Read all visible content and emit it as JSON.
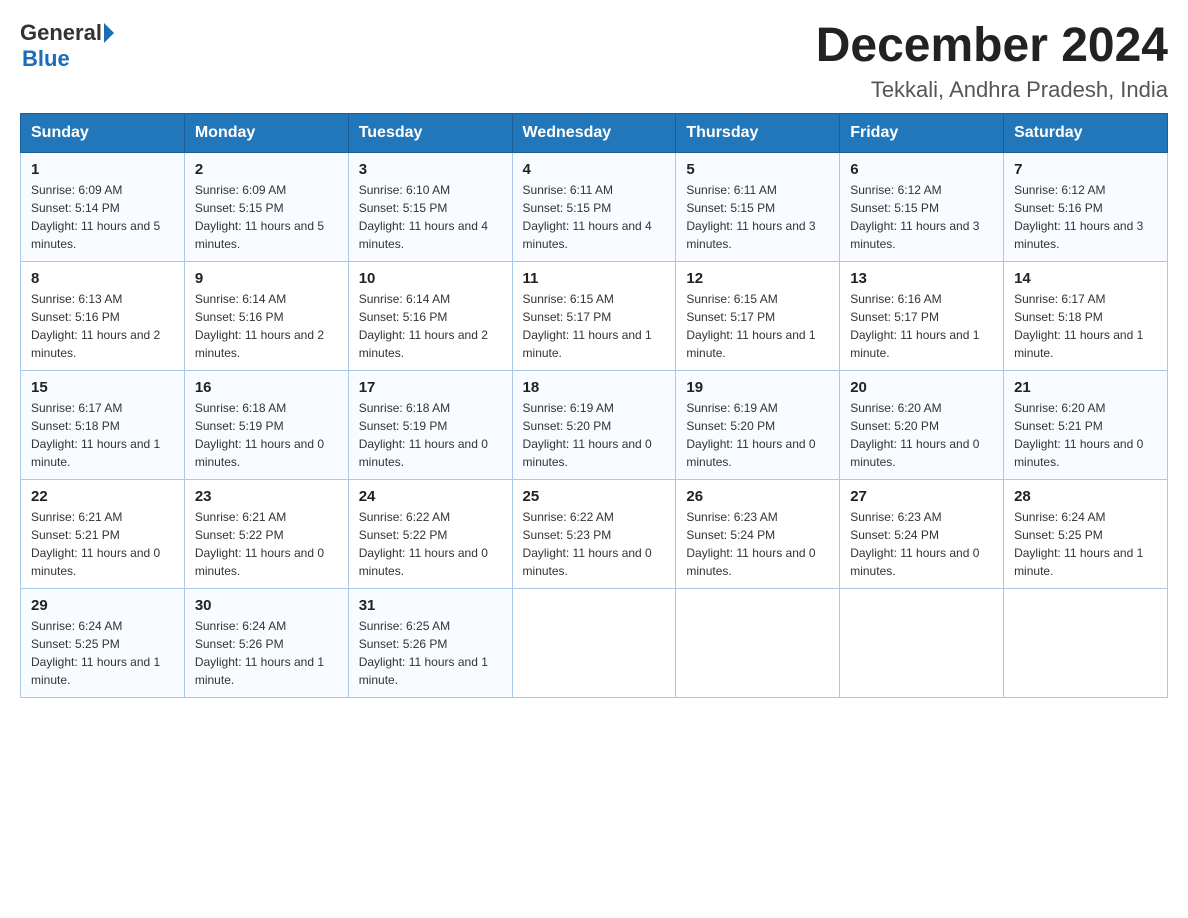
{
  "header": {
    "logo": {
      "general": "General",
      "blue": "Blue"
    },
    "month_title": "December 2024",
    "location": "Tekkali, Andhra Pradesh, India"
  },
  "calendar": {
    "days_of_week": [
      "Sunday",
      "Monday",
      "Tuesday",
      "Wednesday",
      "Thursday",
      "Friday",
      "Saturday"
    ],
    "weeks": [
      [
        {
          "day": "1",
          "sunrise": "Sunrise: 6:09 AM",
          "sunset": "Sunset: 5:14 PM",
          "daylight": "Daylight: 11 hours and 5 minutes."
        },
        {
          "day": "2",
          "sunrise": "Sunrise: 6:09 AM",
          "sunset": "Sunset: 5:15 PM",
          "daylight": "Daylight: 11 hours and 5 minutes."
        },
        {
          "day": "3",
          "sunrise": "Sunrise: 6:10 AM",
          "sunset": "Sunset: 5:15 PM",
          "daylight": "Daylight: 11 hours and 4 minutes."
        },
        {
          "day": "4",
          "sunrise": "Sunrise: 6:11 AM",
          "sunset": "Sunset: 5:15 PM",
          "daylight": "Daylight: 11 hours and 4 minutes."
        },
        {
          "day": "5",
          "sunrise": "Sunrise: 6:11 AM",
          "sunset": "Sunset: 5:15 PM",
          "daylight": "Daylight: 11 hours and 3 minutes."
        },
        {
          "day": "6",
          "sunrise": "Sunrise: 6:12 AM",
          "sunset": "Sunset: 5:15 PM",
          "daylight": "Daylight: 11 hours and 3 minutes."
        },
        {
          "day": "7",
          "sunrise": "Sunrise: 6:12 AM",
          "sunset": "Sunset: 5:16 PM",
          "daylight": "Daylight: 11 hours and 3 minutes."
        }
      ],
      [
        {
          "day": "8",
          "sunrise": "Sunrise: 6:13 AM",
          "sunset": "Sunset: 5:16 PM",
          "daylight": "Daylight: 11 hours and 2 minutes."
        },
        {
          "day": "9",
          "sunrise": "Sunrise: 6:14 AM",
          "sunset": "Sunset: 5:16 PM",
          "daylight": "Daylight: 11 hours and 2 minutes."
        },
        {
          "day": "10",
          "sunrise": "Sunrise: 6:14 AM",
          "sunset": "Sunset: 5:16 PM",
          "daylight": "Daylight: 11 hours and 2 minutes."
        },
        {
          "day": "11",
          "sunrise": "Sunrise: 6:15 AM",
          "sunset": "Sunset: 5:17 PM",
          "daylight": "Daylight: 11 hours and 1 minute."
        },
        {
          "day": "12",
          "sunrise": "Sunrise: 6:15 AM",
          "sunset": "Sunset: 5:17 PM",
          "daylight": "Daylight: 11 hours and 1 minute."
        },
        {
          "day": "13",
          "sunrise": "Sunrise: 6:16 AM",
          "sunset": "Sunset: 5:17 PM",
          "daylight": "Daylight: 11 hours and 1 minute."
        },
        {
          "day": "14",
          "sunrise": "Sunrise: 6:17 AM",
          "sunset": "Sunset: 5:18 PM",
          "daylight": "Daylight: 11 hours and 1 minute."
        }
      ],
      [
        {
          "day": "15",
          "sunrise": "Sunrise: 6:17 AM",
          "sunset": "Sunset: 5:18 PM",
          "daylight": "Daylight: 11 hours and 1 minute."
        },
        {
          "day": "16",
          "sunrise": "Sunrise: 6:18 AM",
          "sunset": "Sunset: 5:19 PM",
          "daylight": "Daylight: 11 hours and 0 minutes."
        },
        {
          "day": "17",
          "sunrise": "Sunrise: 6:18 AM",
          "sunset": "Sunset: 5:19 PM",
          "daylight": "Daylight: 11 hours and 0 minutes."
        },
        {
          "day": "18",
          "sunrise": "Sunrise: 6:19 AM",
          "sunset": "Sunset: 5:20 PM",
          "daylight": "Daylight: 11 hours and 0 minutes."
        },
        {
          "day": "19",
          "sunrise": "Sunrise: 6:19 AM",
          "sunset": "Sunset: 5:20 PM",
          "daylight": "Daylight: 11 hours and 0 minutes."
        },
        {
          "day": "20",
          "sunrise": "Sunrise: 6:20 AM",
          "sunset": "Sunset: 5:20 PM",
          "daylight": "Daylight: 11 hours and 0 minutes."
        },
        {
          "day": "21",
          "sunrise": "Sunrise: 6:20 AM",
          "sunset": "Sunset: 5:21 PM",
          "daylight": "Daylight: 11 hours and 0 minutes."
        }
      ],
      [
        {
          "day": "22",
          "sunrise": "Sunrise: 6:21 AM",
          "sunset": "Sunset: 5:21 PM",
          "daylight": "Daylight: 11 hours and 0 minutes."
        },
        {
          "day": "23",
          "sunrise": "Sunrise: 6:21 AM",
          "sunset": "Sunset: 5:22 PM",
          "daylight": "Daylight: 11 hours and 0 minutes."
        },
        {
          "day": "24",
          "sunrise": "Sunrise: 6:22 AM",
          "sunset": "Sunset: 5:22 PM",
          "daylight": "Daylight: 11 hours and 0 minutes."
        },
        {
          "day": "25",
          "sunrise": "Sunrise: 6:22 AM",
          "sunset": "Sunset: 5:23 PM",
          "daylight": "Daylight: 11 hours and 0 minutes."
        },
        {
          "day": "26",
          "sunrise": "Sunrise: 6:23 AM",
          "sunset": "Sunset: 5:24 PM",
          "daylight": "Daylight: 11 hours and 0 minutes."
        },
        {
          "day": "27",
          "sunrise": "Sunrise: 6:23 AM",
          "sunset": "Sunset: 5:24 PM",
          "daylight": "Daylight: 11 hours and 0 minutes."
        },
        {
          "day": "28",
          "sunrise": "Sunrise: 6:24 AM",
          "sunset": "Sunset: 5:25 PM",
          "daylight": "Daylight: 11 hours and 1 minute."
        }
      ],
      [
        {
          "day": "29",
          "sunrise": "Sunrise: 6:24 AM",
          "sunset": "Sunset: 5:25 PM",
          "daylight": "Daylight: 11 hours and 1 minute."
        },
        {
          "day": "30",
          "sunrise": "Sunrise: 6:24 AM",
          "sunset": "Sunset: 5:26 PM",
          "daylight": "Daylight: 11 hours and 1 minute."
        },
        {
          "day": "31",
          "sunrise": "Sunrise: 6:25 AM",
          "sunset": "Sunset: 5:26 PM",
          "daylight": "Daylight: 11 hours and 1 minute."
        },
        null,
        null,
        null,
        null
      ]
    ]
  }
}
